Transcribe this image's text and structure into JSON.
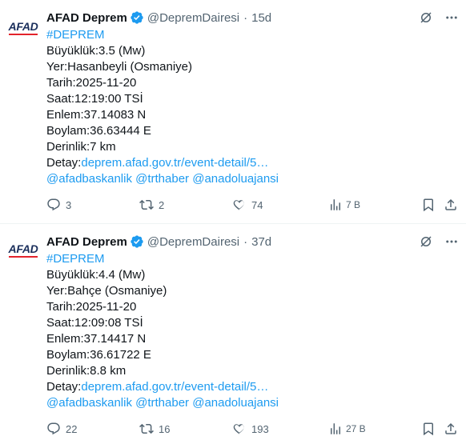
{
  "tweets": [
    {
      "avatar_text": "AFAD",
      "name": "AFAD Deprem",
      "handle": "@DepremDairesi",
      "separator": "·",
      "time": "15d",
      "lines": {
        "hashtag": "#DEPREM",
        "magnitude": "Büyüklük:3.5 (Mw)",
        "location": "Yer:Hasanbeyli (Osmaniye)",
        "date": "Tarih:2025-11-20",
        "clock": "Saat:12:19:00 TSİ",
        "lat": "Enlem:37.14083 N",
        "lon": "Boylam:36.63444 E",
        "depth": "Derinlik:7 km",
        "detail_label": "Detay:",
        "detail_link": "deprem.afad.gov.tr/event-detail/5…",
        "mentions": "@afadbaskanlik @trthaber @anadoluajansi"
      },
      "stats": {
        "replies": "3",
        "reposts": "2",
        "likes": "74",
        "views": "7 B"
      }
    },
    {
      "avatar_text": "AFAD",
      "name": "AFAD Deprem",
      "handle": "@DepremDairesi",
      "separator": "·",
      "time": "37d",
      "lines": {
        "hashtag": "#DEPREM",
        "magnitude": "Büyüklük:4.4 (Mw)",
        "location": "Yer:Bahçe (Osmaniye)",
        "date": "Tarih:2025-11-20",
        "clock": "Saat:12:09:08 TSİ",
        "lat": "Enlem:37.14417 N",
        "lon": "Boylam:36.61722 E",
        "depth": "Derinlik:8.8 km",
        "detail_label": "Detay:",
        "detail_link": "deprem.afad.gov.tr/event-detail/5…",
        "mentions": "@afadbaskanlik @trthaber @anadoluajansi"
      },
      "stats": {
        "replies": "22",
        "reposts": "16",
        "likes": "193",
        "views": "27 B"
      }
    }
  ],
  "colors": {
    "accent": "#1d9bf0",
    "muted": "#536471",
    "text": "#0f1419",
    "brand_red": "#e3232b",
    "brand_navy": "#1b2f5c"
  },
  "icons": [
    "grok-icon",
    "more-icon",
    "verified-badge-icon",
    "reply-icon",
    "repost-icon",
    "like-icon",
    "views-icon",
    "bookmark-icon",
    "share-icon"
  ]
}
